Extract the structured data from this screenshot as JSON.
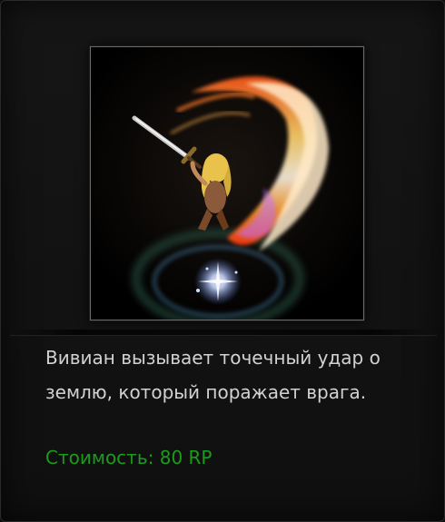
{
  "skill": {
    "image_icon": "sword-slash-skill-icon",
    "description": "Вивиан вызывает точечный удар о землю, который поражает врага.",
    "cost_label": "Стоимость:",
    "cost_value": "80 RP"
  },
  "colors": {
    "cost_text": "#1c9a1c",
    "description_text": "#d2d2d2",
    "background": "#141414"
  }
}
